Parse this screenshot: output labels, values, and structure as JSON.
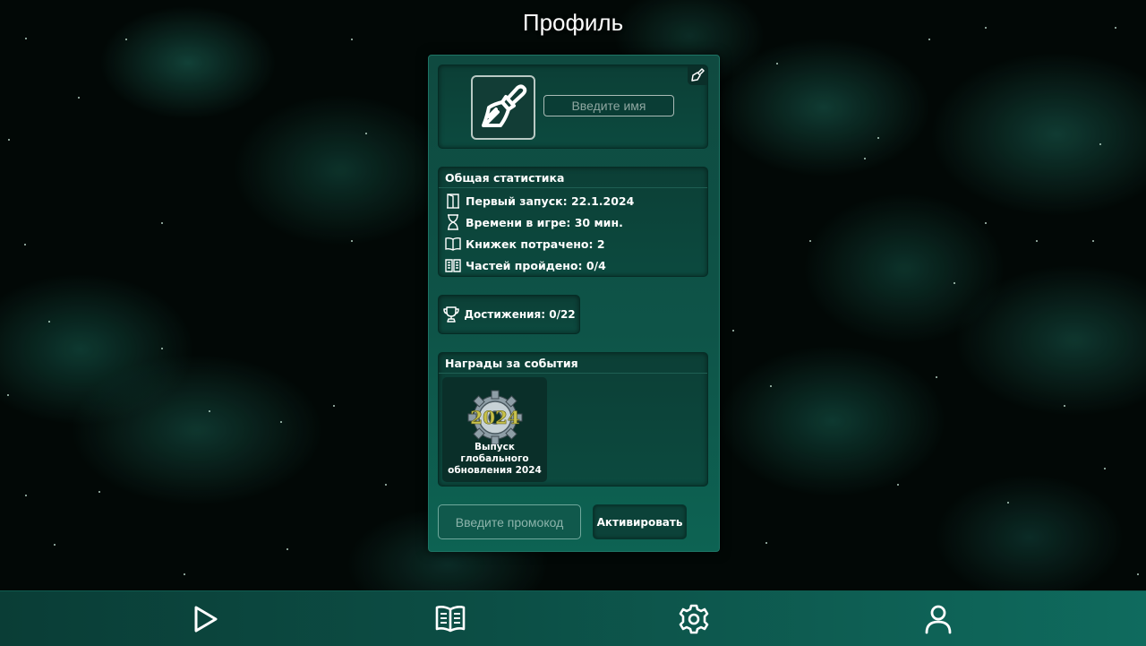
{
  "header": {
    "title": "Профиль"
  },
  "profile": {
    "name_placeholder": "Введите имя",
    "avatar_icon": "brush-icon",
    "edit_icon": "brush-edit-icon"
  },
  "stats": {
    "title": "Общая статистика",
    "items": [
      {
        "icon": "door-icon",
        "label": "Первый запуск: 22.1.2024"
      },
      {
        "icon": "hourglass-icon",
        "label": "Времени в игре: 30 мин."
      },
      {
        "icon": "book-icon",
        "label": "Книжек потрачено: 2"
      },
      {
        "icon": "open-book-icon",
        "label": "Частей пройдено: 0/4"
      }
    ]
  },
  "achievements": {
    "icon": "trophy-icon",
    "label": "Достижения: 0/22"
  },
  "rewards": {
    "title": "Награды за события",
    "items": [
      {
        "icon": "gear-2024-badge",
        "badge_text": "2024",
        "label_line1": "Выпуск глобального",
        "label_line2": "обновления 2024"
      }
    ]
  },
  "promo": {
    "placeholder": "Введите промокод",
    "activate_label": "Активировать"
  },
  "nav": {
    "items": [
      {
        "icon": "play-icon"
      },
      {
        "icon": "book-icon"
      },
      {
        "icon": "gear-icon"
      },
      {
        "icon": "user-icon"
      }
    ]
  },
  "colors": {
    "accent": "#0f6b5e",
    "panel": "#0e5448",
    "card": "#0c4239",
    "background": "#020806"
  }
}
